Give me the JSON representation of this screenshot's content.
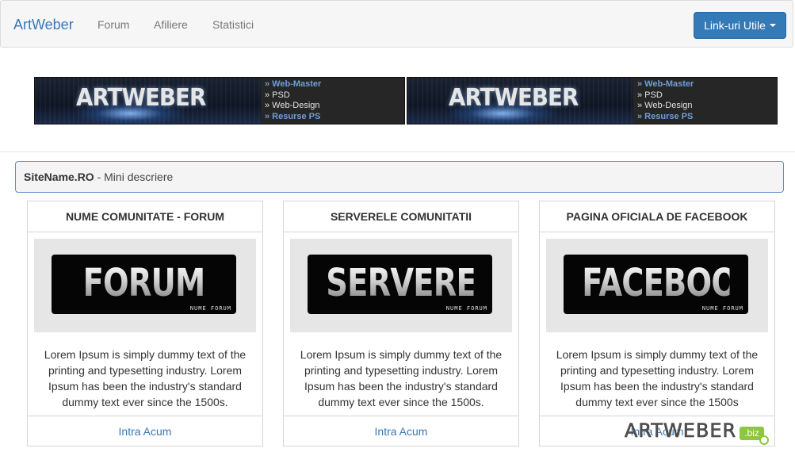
{
  "navbar": {
    "brand": "ArtWeber",
    "links": [
      "Forum",
      "Afiliere",
      "Statistici"
    ],
    "dropdown_label": "Link-uri Utile"
  },
  "banners": [
    {
      "logo": "ARTWEBER",
      "links": [
        "» Web-Master",
        "» PSD",
        "» Web-Design",
        "» Resurse PS"
      ]
    },
    {
      "logo": "ARTWEBER",
      "links": [
        "» Web-Master",
        "» PSD",
        "» Web-Design",
        "» Resurse PS"
      ]
    }
  ],
  "site": {
    "name": "SiteName.RO",
    "description": " - Mini descriere"
  },
  "cards": [
    {
      "title": "NUME COMUNITATE - FORUM",
      "image_word": "FORUM",
      "image_sub": "NUME FORUM",
      "text": "Lorem Ipsum is simply dummy text of the printing and typesetting industry. Lorem Ipsum has been the industry's standard dummy text ever since the 1500s.",
      "link": "Intra Acum"
    },
    {
      "title": "SERVERELE COMUNITATII",
      "image_word": "SERVERE",
      "image_sub": "NUME FORUM",
      "text": "Lorem Ipsum is simply dummy text of the printing and typesetting industry. Lorem Ipsum has been the industry's standard dummy text ever since the 1500s.",
      "link": "Intra Acum"
    },
    {
      "title": "PAGINA OFICIALA DE FACEBOOK",
      "image_word": "FACEBOOK",
      "image_sub": "NUME FORUM",
      "text": "Lorem Ipsum is simply dummy text of the printing and typesetting industry. Lorem Ipsum has been the industry's standard dummy text ever since the 1500s",
      "link": "Intra Acum"
    }
  ],
  "watermark": {
    "text": "ARTWEBER",
    "suffix": ".biz"
  },
  "colors": {
    "link": "#3a76b6",
    "button": "#347ab7",
    "watermark_badge": "#8dc63f"
  }
}
